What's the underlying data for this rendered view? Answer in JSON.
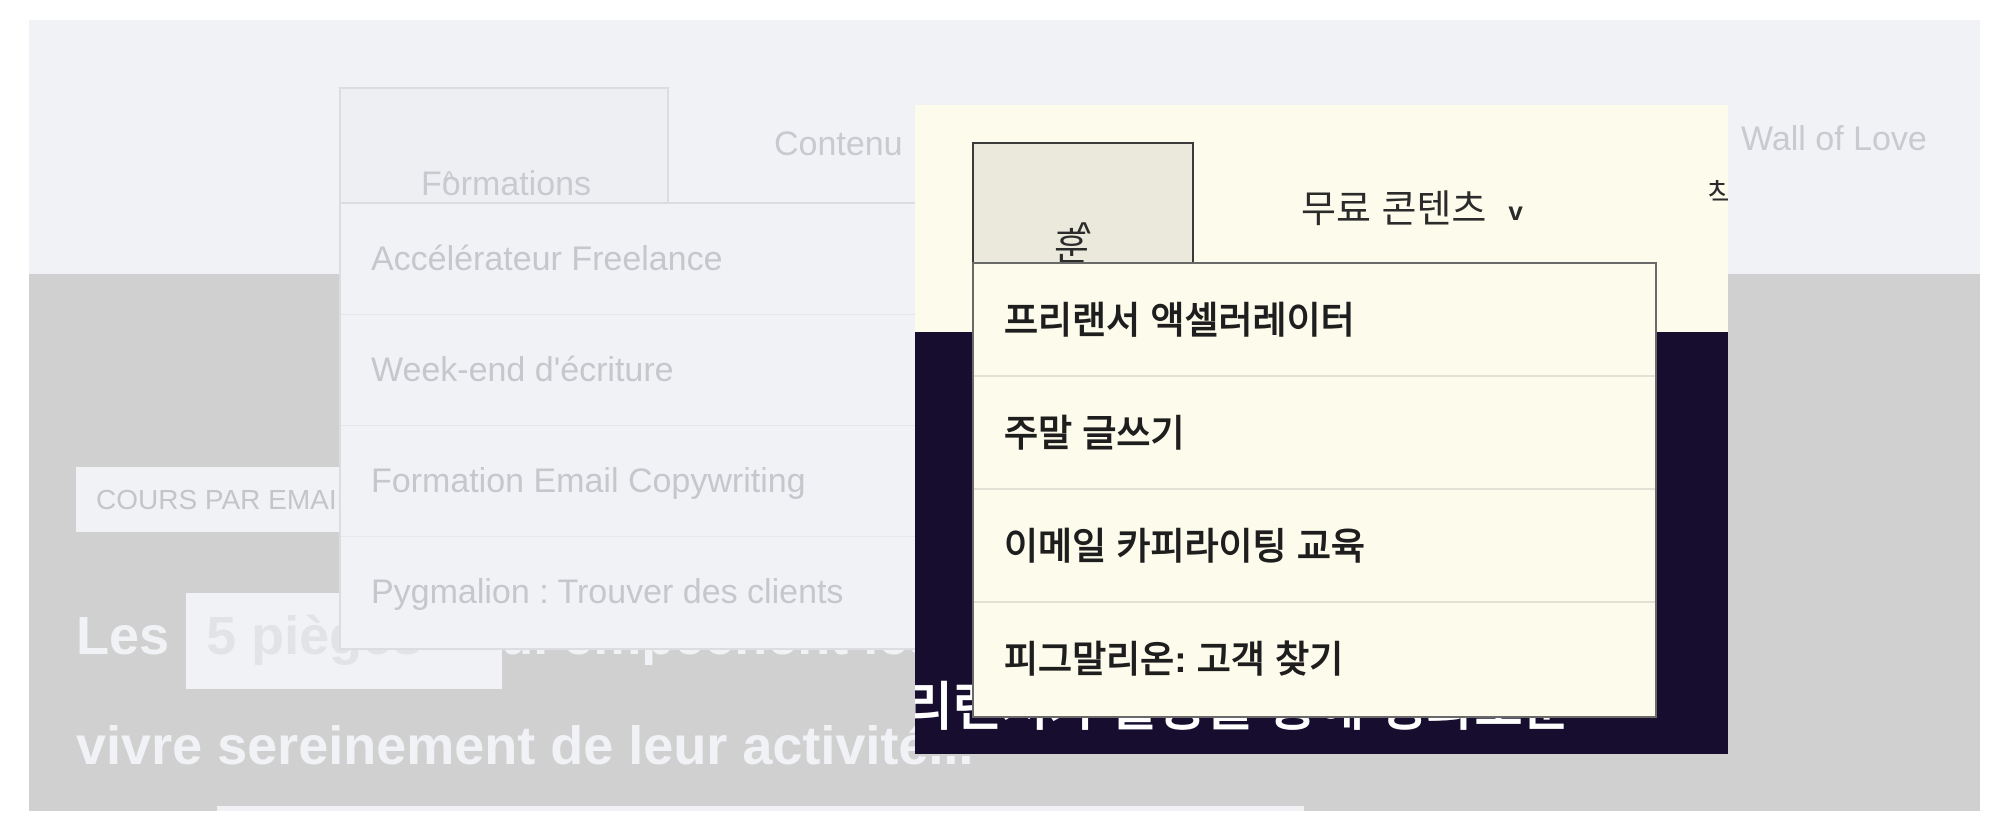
{
  "french_page": {
    "nav": {
      "formations": "Formations",
      "contenus": "Contenu",
      "wall_of_love": "Wall of Love"
    },
    "formations_menu": [
      "Accélérateur Freelance",
      "Week-end d'écriture",
      "Formation Email Copywriting",
      "Pygmalion : Trouver des clients"
    ],
    "badge": "COURS PAR EMAIL",
    "headline": {
      "prefix": "Les",
      "highlight": "5 pièges",
      "rest_line1": "qui empêchent les freelances de",
      "line2": "vivre sereinement de leur activité..."
    }
  },
  "korean_overlay": {
    "nav": {
      "training": "훈련",
      "free_content": "무료 콘텐츠",
      "partial": "칙"
    },
    "training_menu": [
      "프리랜서 액셀러레이터",
      "주말 글쓰기",
      "이메일 카피라이팅 교육",
      "피그말리온: 고객 찾기"
    ],
    "hero_text": "리랜서가 활동을 통해 평화로운"
  },
  "icons": {
    "chevron_up": "^",
    "chevron_down": "v"
  },
  "colors": {
    "korean_bg": "#fdfbeb",
    "korean_dark": "#170d2f",
    "french_header": "#f1f2f6",
    "french_body": "#cfd0cf"
  }
}
